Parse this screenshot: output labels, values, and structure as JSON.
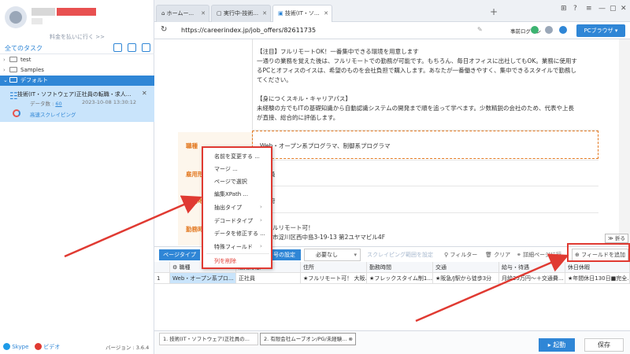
{
  "sidebar": {
    "pay_link": "料金を払いに行く >>",
    "tasks_title": "全てのタスク",
    "tree": [
      {
        "label": "test"
      },
      {
        "label": "Samples"
      },
      {
        "label": "デフォルト"
      }
    ],
    "task": {
      "name": "技術(IT・ソフトウェア)正社員の転職・求人...",
      "data_label": "データ数 : ",
      "data_value": "60",
      "date": "2023-10-08 13:30:12",
      "speed": "高速スクレイピング"
    },
    "bottom": {
      "skype": "Skype",
      "video": "ビデオ",
      "version": "バージョン : 3.6.4"
    }
  },
  "browser": {
    "tabs": [
      {
        "label": "ホームー..."
      },
      {
        "label": "実行中-技術..."
      },
      {
        "label": "技術(IT・ソ..."
      }
    ],
    "url": "https://careerindex.jp/job_offers/82611735",
    "login": "事前ログイン",
    "pc_browser": "PCブラウザ"
  },
  "page": {
    "para1": [
      "【注目】フルリモートOK！一番集中できる環境を用意します",
      "一通りの業務を覚えた後は、フルリモートでの勤務が可能です。もちろん、毎日オフィスに出社してもOK。業務に使用す",
      "るPCとオフィスのイスは、希望のものを会社負担で購入します。あなたが一番働きやすく、集中できるスタイルで勤務し",
      "てください。"
    ],
    "para2": [
      "【身につくスキル・キャリアパス】",
      "未経験の方でもITの基礎知識から自動認識システムの開発まで順を追って学べます。少数精鋭の会社のため、代表や上長",
      "が直接、総合的に評価します。"
    ],
    "label_job": "職種",
    "value_job": "Web・オープン系プログラマ、制御系プログラマ",
    "label_emp": "雇用形態",
    "value_emp": "員",
    "label_loc": "勤務地",
    "value_loc": "府",
    "label_time": "勤務時間",
    "value_remote": "ルリモート可！",
    "value_addr": "市淀川区西中島3-19-13 第2ユヤマビル4F",
    "fold": "折る"
  },
  "toolbar": {
    "page_type": "ページタイプ",
    "set_label": "号の設定",
    "select_value": "必要なし",
    "scroll_range": "スクレイピング範囲を設定",
    "filter": "フィルター",
    "clear": "クリア",
    "detail_page": "詳細ページに行",
    "add_field": "フィールドを追加"
  },
  "table": {
    "headers": [
      "",
      "職種",
      "雇用形態",
      "住所",
      "勤務時間",
      "交通",
      "給与・待遇",
      "休日休暇"
    ],
    "rows": [
      [
        "1",
        "Web・オープン系プロ...",
        "正社員",
        "★フルリモート可！ 大阪...",
        "★フレックスタイム制1...",
        "★阪急/J駅から徒歩3分",
        "月給25万円～＋交通費...",
        "★年間休日130日■完全..."
      ]
    ]
  },
  "bottom": {
    "tabs": [
      {
        "label": "1. 技術(IT・ソフトウェア)正社員の..."
      },
      {
        "label": "2. 有限会社ムーブオン/PG/未経験..."
      }
    ],
    "start": "起動",
    "save": "保存"
  },
  "context_menu": {
    "items": [
      {
        "label": "名前を変更する ..."
      },
      {
        "label": "マージ ..."
      },
      {
        "label": "ページで選択"
      },
      {
        "label": "編集XPath ..."
      },
      {
        "label": "抽出タイプ"
      },
      {
        "label": "デコードタイプ"
      },
      {
        "label": "データを修正する ..."
      },
      {
        "label": "特殊フィールド"
      },
      {
        "label": "列を削除"
      }
    ]
  },
  "colors": {
    "accent": "#2f86d6",
    "highlight": "#e03a32",
    "label": "#e37a23"
  }
}
